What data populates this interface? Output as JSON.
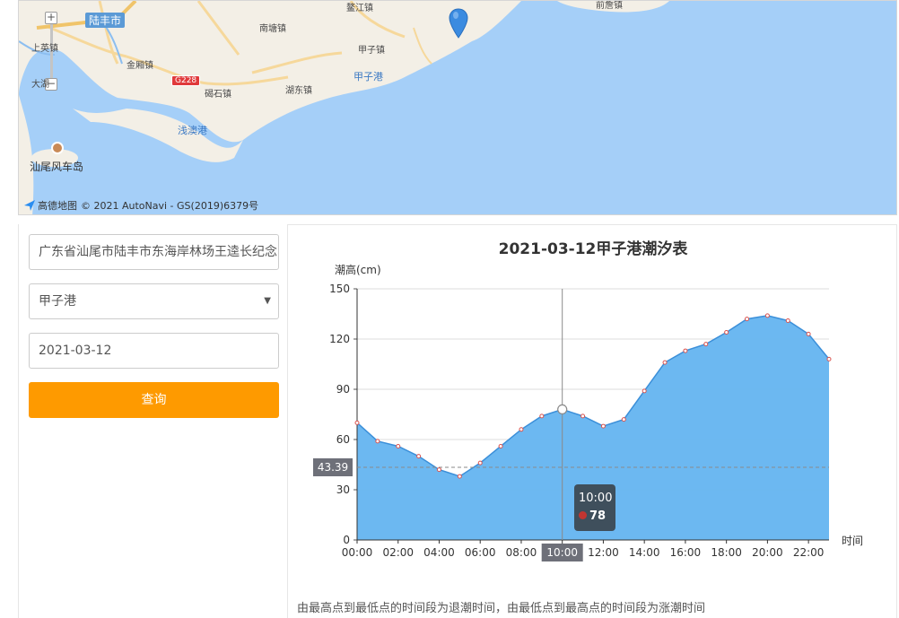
{
  "map": {
    "places": {
      "lufeng": "陆丰市",
      "shangying": "上英镇",
      "dahu": "大湖",
      "jinxiang": "金厢镇",
      "road": "G228",
      "jieshi": "碣石镇",
      "nantang": "南塘镇",
      "aojiang": "鳌江镇",
      "jiazi_town": "甲子镇",
      "jiazi_port": "甲子港",
      "hudong": "湖东镇",
      "qianzhan": "前詹镇",
      "qianaogang": "浅澳港",
      "fengche": "汕尾风车岛"
    },
    "logo_text": "高德地图",
    "copyright": "© 2021 AutoNavi - GS(2019)6379号",
    "zoom_in": "+",
    "zoom_out": "−"
  },
  "form": {
    "address_value": "广东省汕尾市陆丰市东海岸林场王逵长纪念",
    "port_selected": "甲子港",
    "date_value": "2021-03-12",
    "query_label": "查询"
  },
  "chart_data": {
    "type": "area",
    "title": "2021-03-12甲子港潮汐表",
    "ylabel": "潮高(cm)",
    "xlabel": "时间",
    "ylim": [
      0,
      150
    ],
    "yticks": [
      0,
      30,
      60,
      90,
      120,
      150
    ],
    "xticks": [
      "00:00",
      "02:00",
      "04:00",
      "06:00",
      "08:00",
      "10:00",
      "12:00",
      "14:00",
      "16:00",
      "18:00",
      "20:00",
      "22:00"
    ],
    "x": [
      0,
      1,
      2,
      3,
      4,
      5,
      6,
      7,
      8,
      9,
      10,
      11,
      12,
      13,
      14,
      15,
      16,
      17,
      18,
      19,
      20,
      21,
      22,
      23
    ],
    "values": [
      70,
      59,
      56,
      50,
      42,
      38,
      46,
      56,
      66,
      74,
      78,
      74,
      68,
      72,
      89,
      106,
      113,
      117,
      124,
      132,
      134,
      131,
      123,
      108
    ],
    "pointer": {
      "y_value": "43.39",
      "x_label": "10:00"
    },
    "tooltip": {
      "time": "10:00",
      "value": "78"
    },
    "colors": {
      "area": "#64b4f0",
      "line": "#3b8fd9",
      "marker": "#c23531",
      "axis_pointer": "#6e7079"
    },
    "grid": true
  },
  "footnote": "由最高点到最低点的时间段为退潮时间，由最低点到最高点的时间段为涨潮时间"
}
